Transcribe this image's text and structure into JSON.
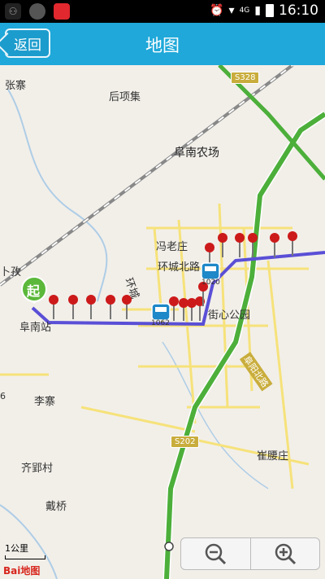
{
  "statusbar": {
    "network": "4G",
    "time": "16:10"
  },
  "header": {
    "back_label": "返回",
    "title": "地图"
  },
  "map": {
    "labels": {
      "zhangzhai": "张寨",
      "houxiangji": "后项集",
      "fnnongchang": "阜南农场",
      "fengzhuang": "冯老庄",
      "huanchengbei": "环城北路",
      "buzhen": "卜孜",
      "funanzhan": "阜南站",
      "jiexinpark": "街心公园",
      "huancheng": "环城",
      "lizhai": "李寨",
      "qiyuncun": "齐郢村",
      "daiqiao": "戴桥",
      "cuiyaozhuang": "崔腰庄",
      "fuyang_expressway": "阜阳北路",
      "partial_6": "6"
    },
    "road_badges": {
      "s328": "S328",
      "s202": "S202"
    },
    "bus_labels": {
      "bus1": "1062",
      "bus2": "1020"
    },
    "start_label": "起",
    "scale": "1公里",
    "logo": "Bai地图"
  },
  "colors": {
    "titlebar": "#1fa8d9",
    "route": "#5a4fd6",
    "expressway": "#4caf3a",
    "road": "#f6e27a",
    "pin": "#cc1a1a"
  }
}
